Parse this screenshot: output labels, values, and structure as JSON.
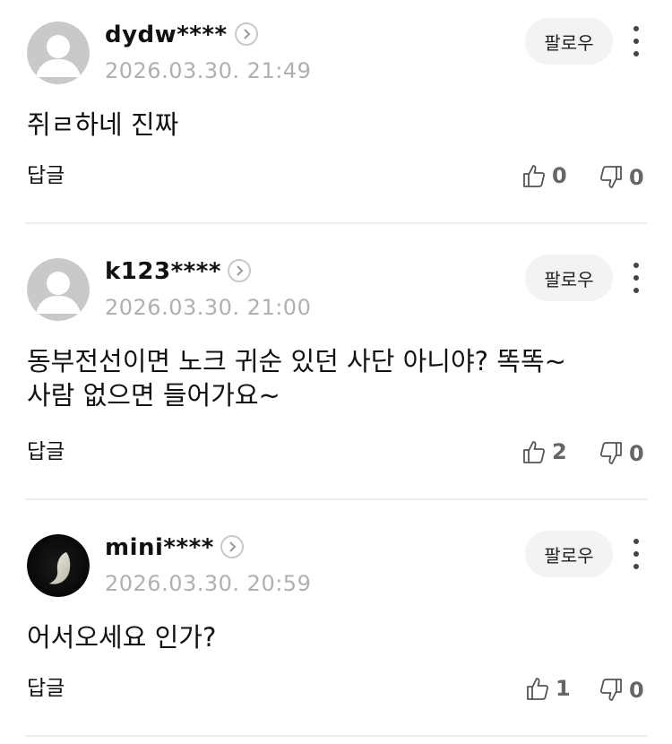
{
  "comments": [
    {
      "username": "dydw****",
      "date": "2026.03.30. 21:49",
      "follow_label": "팔로우",
      "body": [
        "쥐ㄹ하네 진짜"
      ],
      "reply_label": "답글",
      "likes": "0",
      "dislikes": "0",
      "avatar": "default-avatar"
    },
    {
      "username": "k123****",
      "date": "2026.03.30. 21:00",
      "follow_label": "팔로우",
      "body": [
        "동부전선이면 노크 귀순 있던 사단 아니야? 똑똑~",
        "사람 없으면 들어가요~"
      ],
      "reply_label": "답글",
      "likes": "2",
      "dislikes": "0",
      "avatar": "default-avatar"
    },
    {
      "username": "mini****",
      "date": "2026.03.30. 20:59",
      "follow_label": "팔로우",
      "body": [
        "어서오세요 인가?"
      ],
      "reply_label": "답글",
      "likes": "1",
      "dislikes": "0",
      "avatar": "moon-avatar"
    }
  ],
  "icons": {
    "like": "thumbs-up-icon",
    "dislike": "thumbs-down-icon",
    "more": "more-vertical-icon",
    "profile": "chevron-right-icon"
  },
  "colors": {
    "date_text": "#b0b0b0",
    "follow_bg": "#f3f3f5",
    "count_text": "#666666",
    "divider": "#ececec"
  }
}
